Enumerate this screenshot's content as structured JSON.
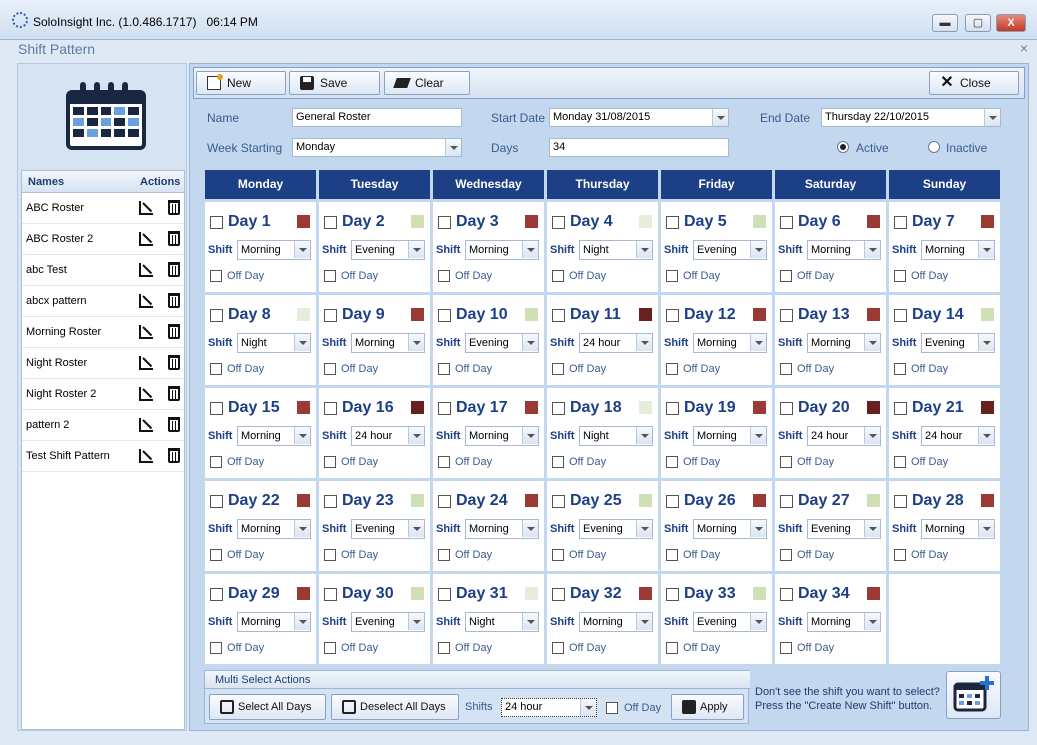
{
  "window": {
    "title": "SoloInsight Inc. (1.0.486.1717)",
    "time": "06:14 PM",
    "min": "▬",
    "max": "▢",
    "close": "X"
  },
  "dialog": {
    "title": "Shift Pattern",
    "close": "×"
  },
  "sidebar": {
    "header_names": "Names",
    "header_actions": "Actions",
    "items": [
      "ABC Roster",
      "ABC Roster 2",
      "abc Test",
      "abcx pattern",
      "Morning Roster",
      "Night Roster",
      "Night Roster 2",
      "pattern 2",
      "Test Shift Pattern"
    ]
  },
  "toolbar": {
    "new": "New",
    "save": "Save",
    "clear": "Clear",
    "close": "Close"
  },
  "form": {
    "name_label": "Name",
    "name_value": "General Roster",
    "start_label": "Start Date",
    "start_value": "Monday 31/08/2015",
    "end_label": "End Date",
    "end_value": "Thursday 22/10/2015",
    "week_label": "Week Starting",
    "week_value": "Monday",
    "days_label": "Days",
    "days_value": "34",
    "active": "Active",
    "inactive": "Inactive",
    "status_selected": "Active"
  },
  "colors": {
    "dark_red": "#9b3a35",
    "maroon": "#6b2020",
    "light_green": "#cfe0b4",
    "pale": "#e4eedb",
    "header_blue": "#1c3f86"
  },
  "weekdays": [
    "Monday",
    "Tuesday",
    "Wednesday",
    "Thursday",
    "Friday",
    "Saturday",
    "Sunday"
  ],
  "shift_label": "Shift",
  "offday_label": "Off Day",
  "days": [
    {
      "label": "Day 1",
      "shift": "Morning",
      "color": "#9b3a35"
    },
    {
      "label": "Day 2",
      "shift": "Evening",
      "color": "#cfe0b4"
    },
    {
      "label": "Day 3",
      "shift": "Morning",
      "color": "#9b3a35"
    },
    {
      "label": "Day 4",
      "shift": "Night",
      "color": "#e4eedb"
    },
    {
      "label": "Day 5",
      "shift": "Evening",
      "color": "#cfe0b4"
    },
    {
      "label": "Day 6",
      "shift": "Morning",
      "color": "#9b3a35"
    },
    {
      "label": "Day 7",
      "shift": "Morning",
      "color": "#9b3a35"
    },
    {
      "label": "Day 8",
      "shift": "Night",
      "color": "#e4eedb"
    },
    {
      "label": "Day 9",
      "shift": "Morning",
      "color": "#9b3a35"
    },
    {
      "label": "Day 10",
      "shift": "Evening",
      "color": "#cfe0b4"
    },
    {
      "label": "Day 11",
      "shift": "24 hour",
      "color": "#6b2020"
    },
    {
      "label": "Day 12",
      "shift": "Morning",
      "color": "#9b3a35"
    },
    {
      "label": "Day 13",
      "shift": "Morning",
      "color": "#9b3a35"
    },
    {
      "label": "Day 14",
      "shift": "Evening",
      "color": "#cfe0b4"
    },
    {
      "label": "Day 15",
      "shift": "Morning",
      "color": "#9b3a35"
    },
    {
      "label": "Day 16",
      "shift": "24 hour",
      "color": "#6b2020"
    },
    {
      "label": "Day 17",
      "shift": "Morning",
      "color": "#9b3a35"
    },
    {
      "label": "Day 18",
      "shift": "Night",
      "color": "#e4eedb"
    },
    {
      "label": "Day 19",
      "shift": "Morning",
      "color": "#9b3a35"
    },
    {
      "label": "Day 20",
      "shift": "24 hour",
      "color": "#6b2020"
    },
    {
      "label": "Day 21",
      "shift": "24 hour",
      "color": "#6b2020"
    },
    {
      "label": "Day 22",
      "shift": "Morning",
      "color": "#9b3a35"
    },
    {
      "label": "Day 23",
      "shift": "Evening",
      "color": "#cfe0b4"
    },
    {
      "label": "Day 24",
      "shift": "Morning",
      "color": "#9b3a35"
    },
    {
      "label": "Day 25",
      "shift": "Evening",
      "color": "#cfe0b4"
    },
    {
      "label": "Day 26",
      "shift": "Morning",
      "color": "#9b3a35"
    },
    {
      "label": "Day 27",
      "shift": "Evening",
      "color": "#cfe0b4"
    },
    {
      "label": "Day 28",
      "shift": "Morning",
      "color": "#9b3a35"
    },
    {
      "label": "Day 29",
      "shift": "Morning",
      "color": "#9b3a35"
    },
    {
      "label": "Day 30",
      "shift": "Evening",
      "color": "#cfe0b4"
    },
    {
      "label": "Day 31",
      "shift": "Night",
      "color": "#e4eedb"
    },
    {
      "label": "Day 32",
      "shift": "Morning",
      "color": "#9b3a35"
    },
    {
      "label": "Day 33",
      "shift": "Evening",
      "color": "#cfe0b4"
    },
    {
      "label": "Day 34",
      "shift": "Morning",
      "color": "#9b3a35"
    }
  ],
  "multi": {
    "title": "Multi Select Actions",
    "select_all": "Select All Days",
    "deselect_all": "Deselect All Days",
    "shifts_label": "Shifts",
    "shifts_value": "24 hour",
    "offday": "Off Day",
    "apply": "Apply"
  },
  "hint": {
    "line1": "Don't see the shift you want to select?",
    "line2": "Press the \"Create New Shift\" button."
  },
  "icons": {
    "app": "soloinsight-logo-icon",
    "calendar": "calendar-icon",
    "edit": "edit-icon",
    "delete": "trash-icon",
    "create_shift": "create-shift-icon"
  }
}
